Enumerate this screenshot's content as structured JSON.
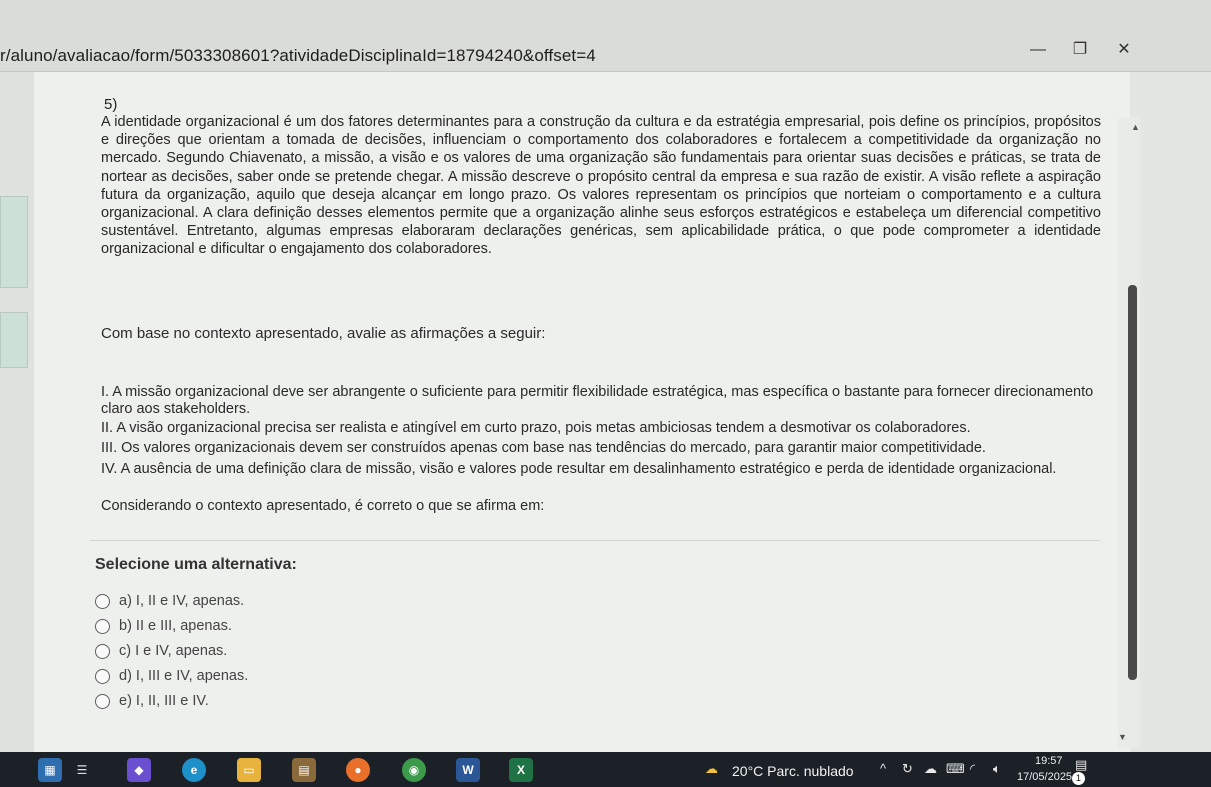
{
  "browser": {
    "url": "r/aluno/avaliacao/form/5033308601?atividadeDisciplinaId=18794240&offset=4",
    "minimize_icon": "minimize-icon",
    "restore_icon": "restore-icon",
    "close_icon": "close-icon",
    "bookmark_icon": "star-icon",
    "profile_icon": "profile-icon",
    "menu_icon": "kebab-menu-icon"
  },
  "question": {
    "number": "5)",
    "paragraph": "A identidade organizacional é um dos fatores determinantes para a construção da cultura e da estratégia empresarial, pois define os princípios, propósitos e direções que orientam a tomada de decisões, influenciam o comportamento dos colaboradores e fortalecem a competitividade da organização no mercado. Segundo Chiavenato, a missão, a visão e os valores de uma organização são fundamentais para orientar suas decisões e práticas, se trata de nortear as decisões, saber onde se pretende chegar. A missão descreve o propósito central da empresa e sua razão de existir. A visão reflete a aspiração futura da organização, aquilo que deseja alcançar em longo prazo. Os valores representam os princípios que norteiam o comportamento e a cultura organizacional. A clara definição desses elementos permite que a organização alinhe seus esforços estratégicos e estabeleça um diferencial competitivo sustentável. Entretanto, algumas empresas elaboraram declarações genéricas, sem aplicabilidade prática, o que pode comprometer a identidade organizacional e dificultar o engajamento dos colaboradores.",
    "prompt": "Com base no contexto apresentado, avalie as afirmações a seguir:",
    "statements": [
      "I. A missão organizacional deve ser abrangente o suficiente para permitir flexibilidade estratégica, mas específica o bastante para fornecer direcionamento claro aos stakeholders.",
      "II. A visão organizacional precisa ser realista e atingível em curto prazo, pois metas ambiciosas tendem a desmotivar os colaboradores.",
      "III. Os valores organizacionais devem ser construídos apenas com base nas tendências do mercado, para garantir maior competitividade.",
      "IV. A ausência de uma definição clara de missão, visão e valores pode resultar em desalinhamento estratégico e perda de identidade organizacional."
    ],
    "conclusion": "Considerando o contexto apresentado, é correto o que se afirma em:",
    "select_label": "Selecione uma alternativa:",
    "options": [
      "a) I, II e IV, apenas.",
      "b) II e III, apenas.",
      "c) I e IV, apenas.",
      "d) I, III e IV, apenas.",
      "e) I, II, III e IV."
    ]
  },
  "taskbar": {
    "weather": "20°C  Parc. nublado",
    "time": "19:57",
    "date": "17/05/2025",
    "notification_count": "1",
    "apps": [
      "task-view-icon",
      "files-icon",
      "edge-icon",
      "explorer-icon",
      "calculator-icon",
      "firefox-icon",
      "chrome-icon",
      "word-icon",
      "excel-icon"
    ]
  }
}
